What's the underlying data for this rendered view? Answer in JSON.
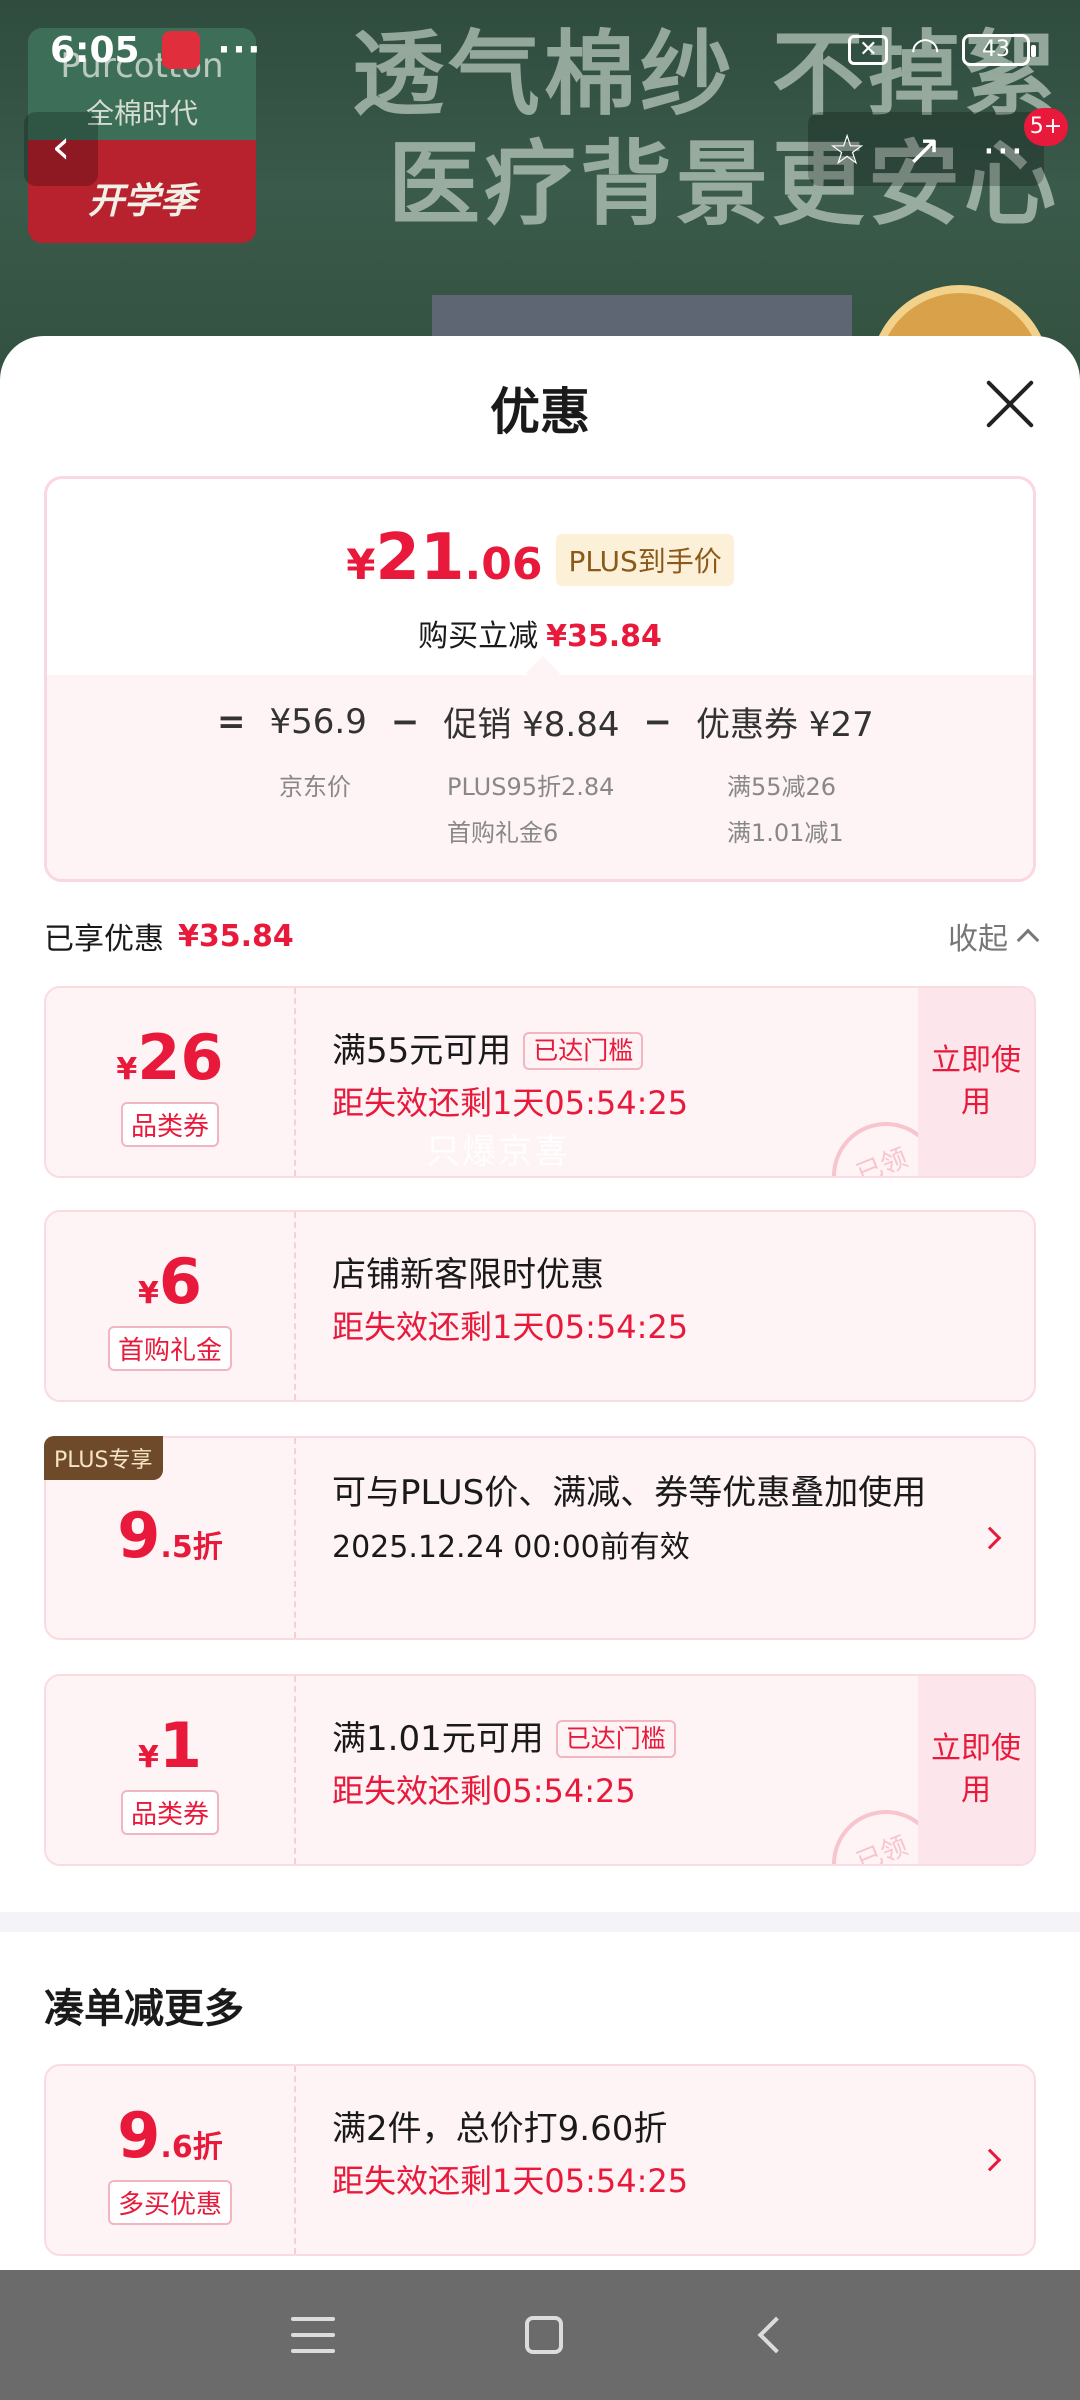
{
  "status_bar": {
    "time": "6:05",
    "dots": "···",
    "battery": "43"
  },
  "background": {
    "headline_line1": "透气棉纱 不掉絮",
    "headline_line2": "医疗背景更安心",
    "logo_brand": "Purcotton",
    "logo_tagline": "全棉时代",
    "logo_campaign": "开学季"
  },
  "header_nav": {
    "message_badge": "5+"
  },
  "sheet": {
    "title": "优惠"
  },
  "summary": {
    "currency": "¥",
    "price_int": "21",
    "price_dec": ".06",
    "plus_tag": "PLUS到手价",
    "save_label": "购买立减",
    "save_amount": "¥35.84",
    "eq_sign": "=",
    "jd_price": "¥56.9",
    "minus1": "−",
    "promo": "促销 ¥8.84",
    "minus2": "−",
    "coupon_total": "优惠券 ¥27",
    "jd_price_label": "京东价",
    "promo_detail_1": "PLUS95折2.84",
    "promo_detail_2": "首购礼金6",
    "coupon_detail_1": "满55减26",
    "coupon_detail_2": "满1.01减1"
  },
  "enjoyed": {
    "label": "已享优惠",
    "amount": "¥35.84",
    "collapse_label": "收起"
  },
  "coupons": [
    {
      "currency": "¥",
      "amount": "26",
      "tag": "品类券",
      "title": "满55元可用",
      "threshold": "已达门槛",
      "expire": "距失效还剩1天05:54:25",
      "action": "立即使用",
      "stamp": "已领",
      "watermark": "只爆京喜"
    },
    {
      "currency": "¥",
      "amount": "6",
      "tag": "首购礼金",
      "title": "店铺新客限时优惠",
      "expire": "距失效还剩1天05:54:25"
    },
    {
      "corner": "PLUS专享",
      "amount": "9",
      "amount_small": ".5折",
      "title": "可与PLUS价、满减、券等优惠叠加使用",
      "expire": "2025.12.24 00:00前有效"
    },
    {
      "currency": "¥",
      "amount": "1",
      "tag": "品类券",
      "title": "满1.01元可用",
      "threshold": "已达门槛",
      "expire": "距失效还剩05:54:25",
      "action": "立即使用",
      "stamp": "已领"
    }
  ],
  "more_section": {
    "title": "凑单减更多",
    "card": {
      "amount": "9",
      "amount_small": ".6折",
      "tag": "多买优惠",
      "title": "满2件，总价打9.60折",
      "expire": "距失效还剩1天05:54:25"
    }
  },
  "colors": {
    "accent": "#e8193a",
    "card_bg": "#fef3f5",
    "plus_gold": "#8a5a1a"
  }
}
